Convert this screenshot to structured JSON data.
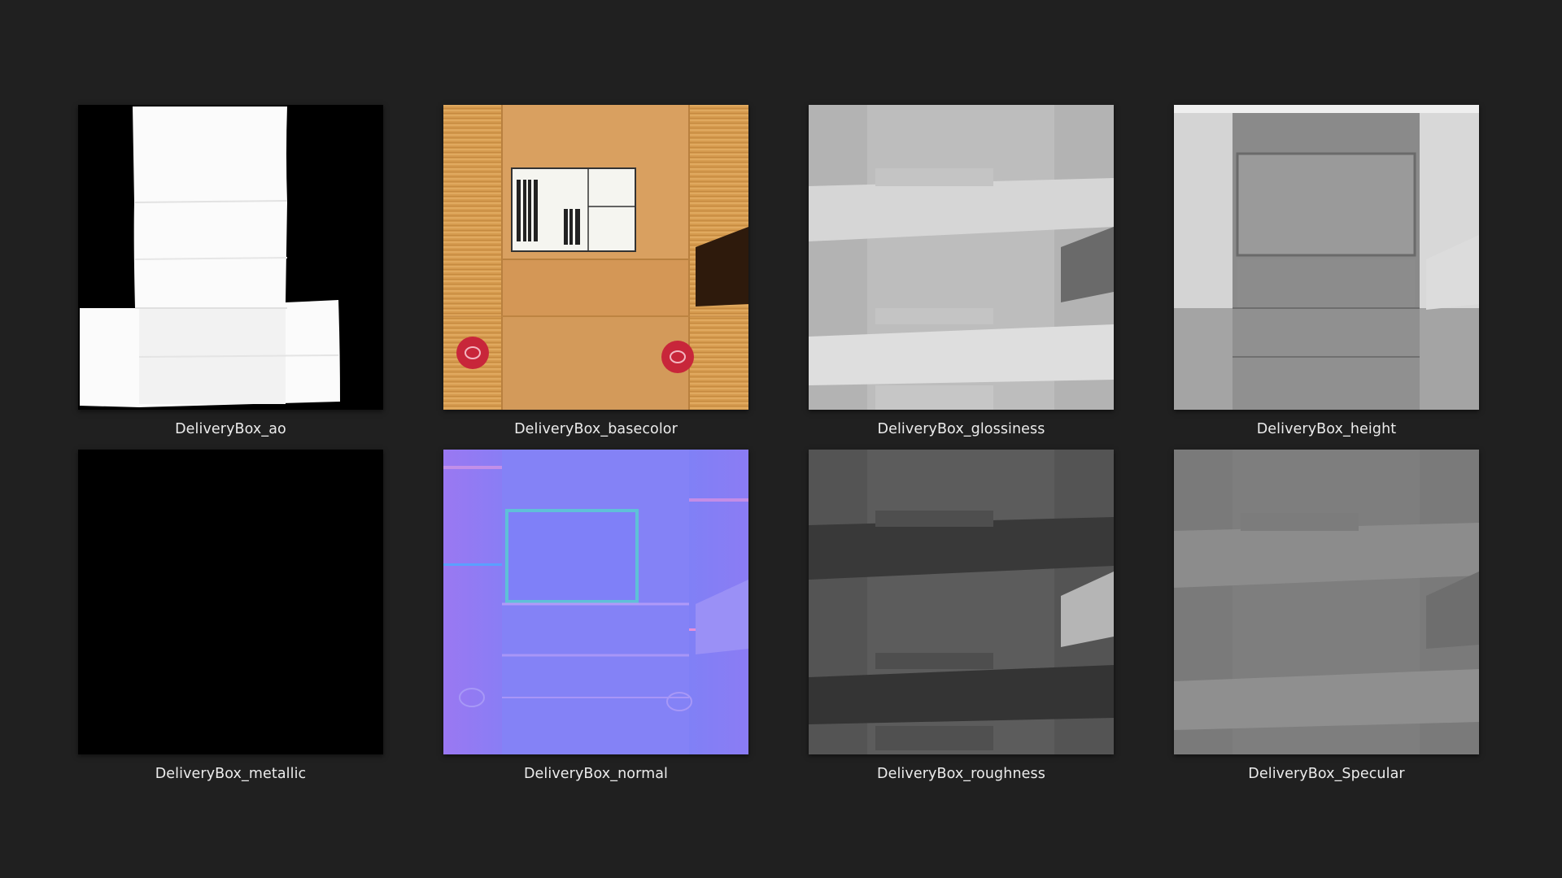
{
  "files": [
    {
      "name": "DeliveryBox_ao"
    },
    {
      "name": "DeliveryBox_basecolor"
    },
    {
      "name": "DeliveryBox_glossiness"
    },
    {
      "name": "DeliveryBox_height"
    },
    {
      "name": "DeliveryBox_metallic"
    },
    {
      "name": "DeliveryBox_normal"
    },
    {
      "name": "DeliveryBox_roughness"
    },
    {
      "name": "DeliveryBox_Specular"
    }
  ],
  "colors": {
    "background": "#202020",
    "label": "#ececec",
    "cardboard": "#d59a4e",
    "normal_base": "#8080ff"
  }
}
